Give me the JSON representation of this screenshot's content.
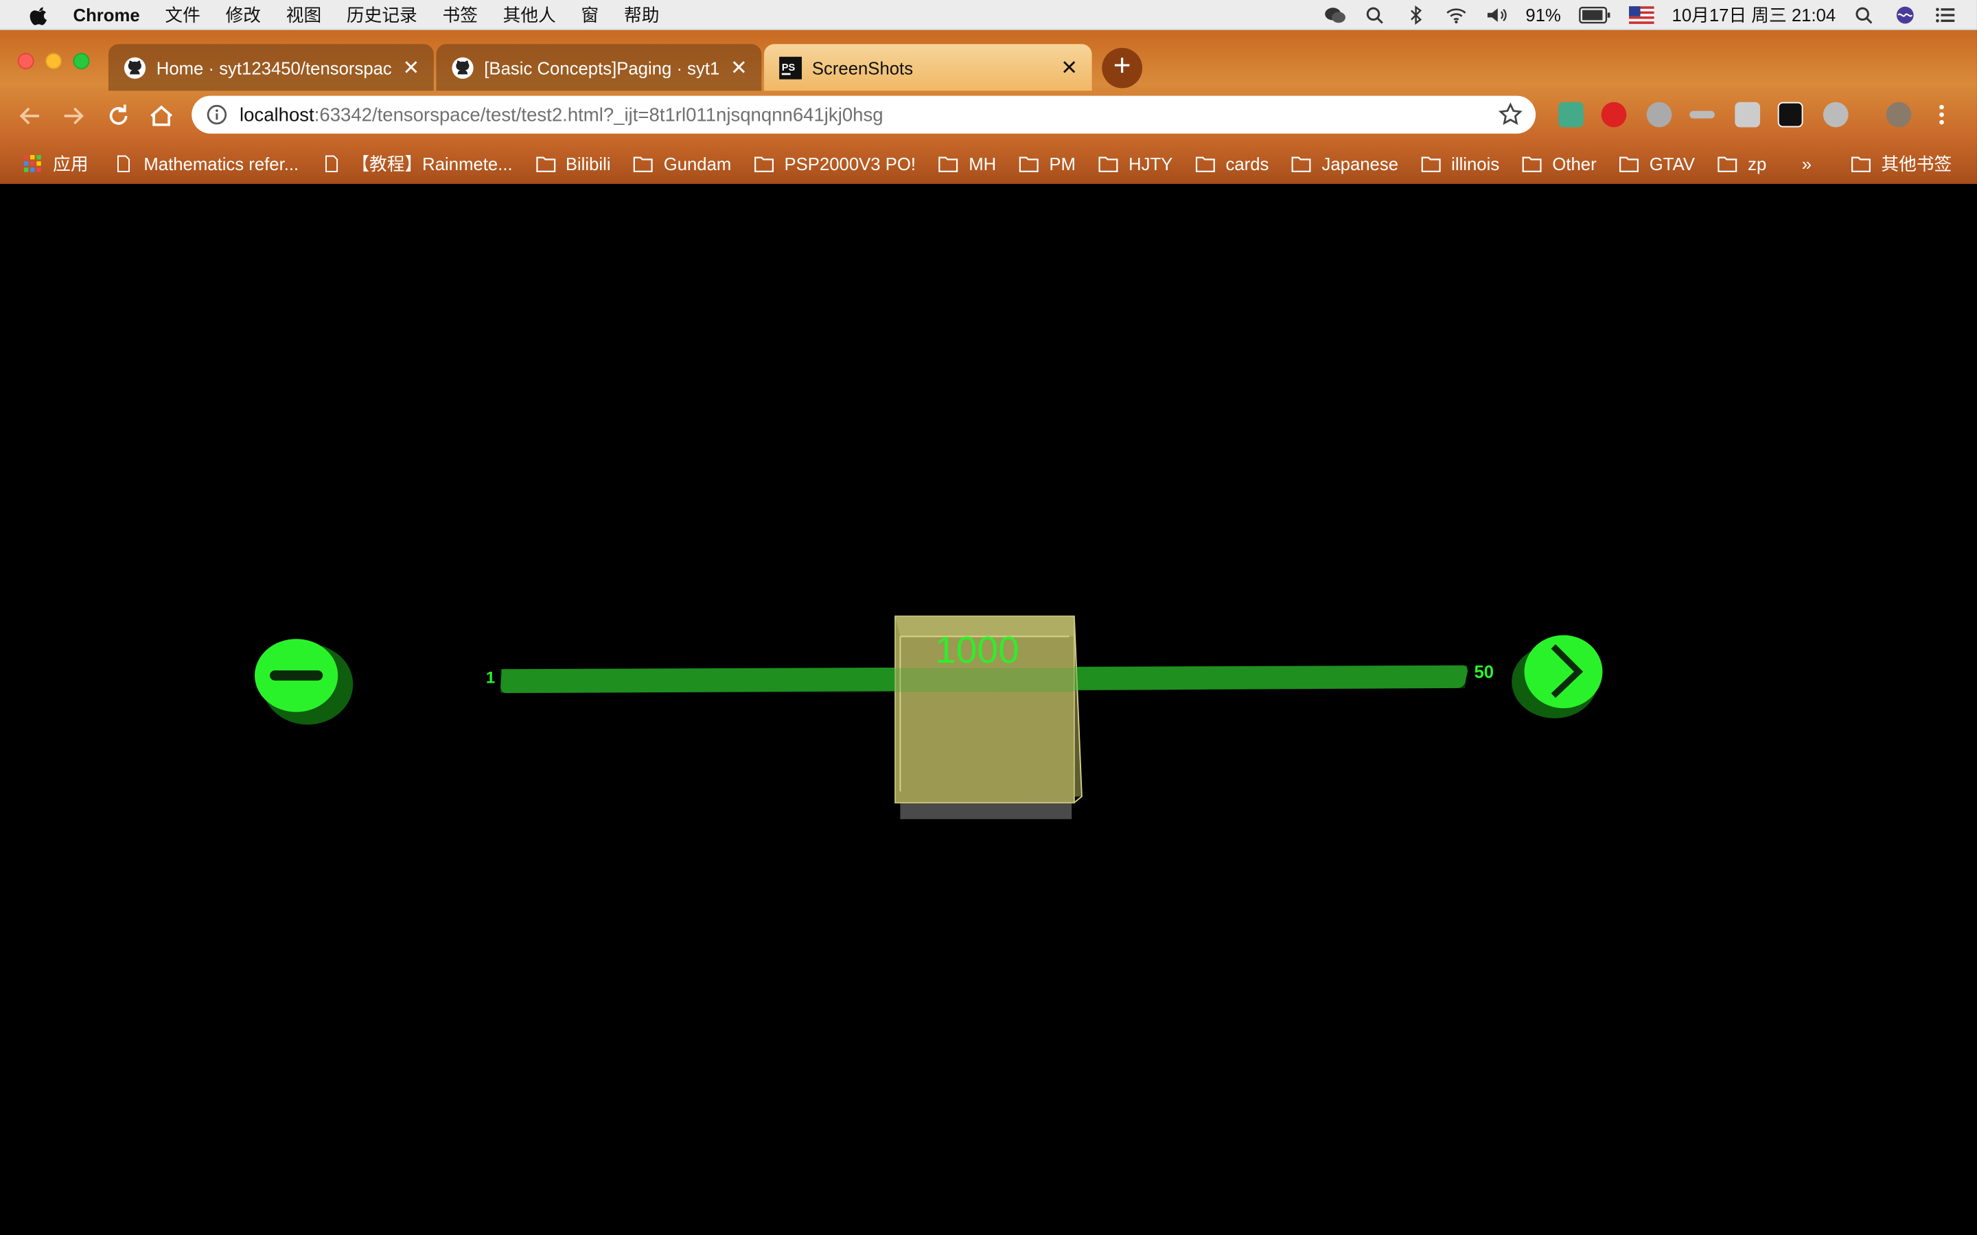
{
  "menubar": {
    "app_name": "Chrome",
    "items": [
      "文件",
      "修改",
      "视图",
      "历史记录",
      "书签",
      "其他人",
      "窗",
      "帮助"
    ],
    "battery": "91%",
    "datetime": "10月17日 周三  21:04"
  },
  "tabs": [
    {
      "title": "Home · syt123450/tensorspac",
      "icon": "github-icon",
      "active": false
    },
    {
      "title": "[Basic Concepts]Paging · syt1",
      "icon": "github-icon",
      "active": false
    },
    {
      "title": "ScreenShots",
      "icon": "phpstorm-icon",
      "active": true
    }
  ],
  "address_bar": {
    "host": "localhost",
    "rest": ":63342/tensorspace/test/test2.html?_ijt=8t1rl011njsqnqnn641jkj0hsg"
  },
  "bookmarks": [
    {
      "label": "应用",
      "icon": "apps-grid-icon"
    },
    {
      "label": "Mathematics refer...",
      "icon": "page-icon"
    },
    {
      "label": "【教程】Rainmete...",
      "icon": "page-icon"
    },
    {
      "label": "Bilibili",
      "icon": "folder-icon"
    },
    {
      "label": "Gundam",
      "icon": "folder-icon"
    },
    {
      "label": "PSP2000V3 PO!",
      "icon": "folder-icon"
    },
    {
      "label": "MH",
      "icon": "folder-icon"
    },
    {
      "label": "PM",
      "icon": "folder-icon"
    },
    {
      "label": "HJTY",
      "icon": "folder-icon"
    },
    {
      "label": "cards",
      "icon": "folder-icon"
    },
    {
      "label": "Japanese",
      "icon": "folder-icon"
    },
    {
      "label": "illinois",
      "icon": "folder-icon"
    },
    {
      "label": "Other",
      "icon": "folder-icon"
    },
    {
      "label": "GTAV",
      "icon": "folder-icon"
    },
    {
      "label": "zp",
      "icon": "folder-icon"
    }
  ],
  "bookmarks_overflow": "»",
  "other_bookmarks": "其他书签",
  "scene": {
    "range_start": "1",
    "range_end": "50",
    "box_label": "1000",
    "colors": {
      "accent_green": "#2af22a",
      "bar_green": "#1f8f1f",
      "box_fill": "#a8a65c"
    }
  }
}
